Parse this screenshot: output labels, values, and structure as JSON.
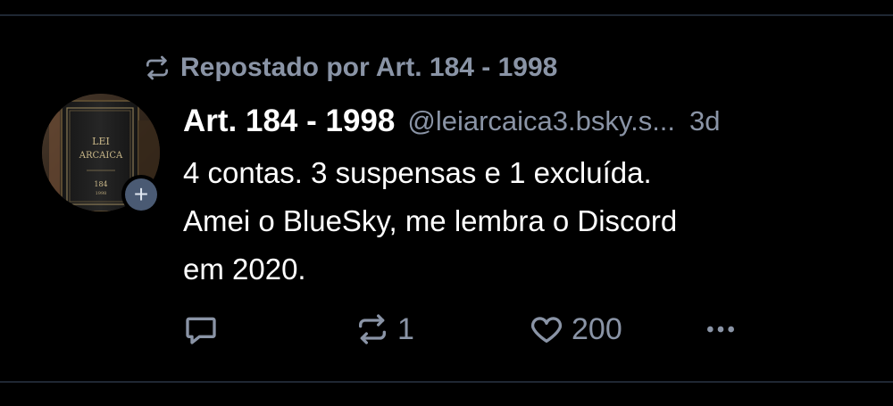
{
  "repost_banner": {
    "icon": "repost-icon",
    "text": "Repostado por Art. 184 - 1998"
  },
  "author": {
    "display_name": "Art. 184 - 1998",
    "handle": "@leiarcaica3.bsky.s...",
    "avatar_text": {
      "line1": "LEI",
      "line2": "ARCAICA",
      "number": "184",
      "year": "1998"
    }
  },
  "post": {
    "time": "3d",
    "text": "4 contas. 3 suspensas e 1 excluída.\nAmei o BlueSky, me lembra o Discord\nem 2020."
  },
  "actions": {
    "reply": {
      "icon": "reply-icon",
      "count": ""
    },
    "repost": {
      "icon": "repost-icon",
      "count": "1"
    },
    "like": {
      "icon": "heart-icon",
      "count": "200"
    },
    "more": {
      "icon": "more-icon"
    }
  },
  "colors": {
    "background": "#000000",
    "muted": "#8a94a6",
    "text": "#ffffff",
    "follow_badge": "#4a5a73",
    "divider": "#1f2733"
  }
}
